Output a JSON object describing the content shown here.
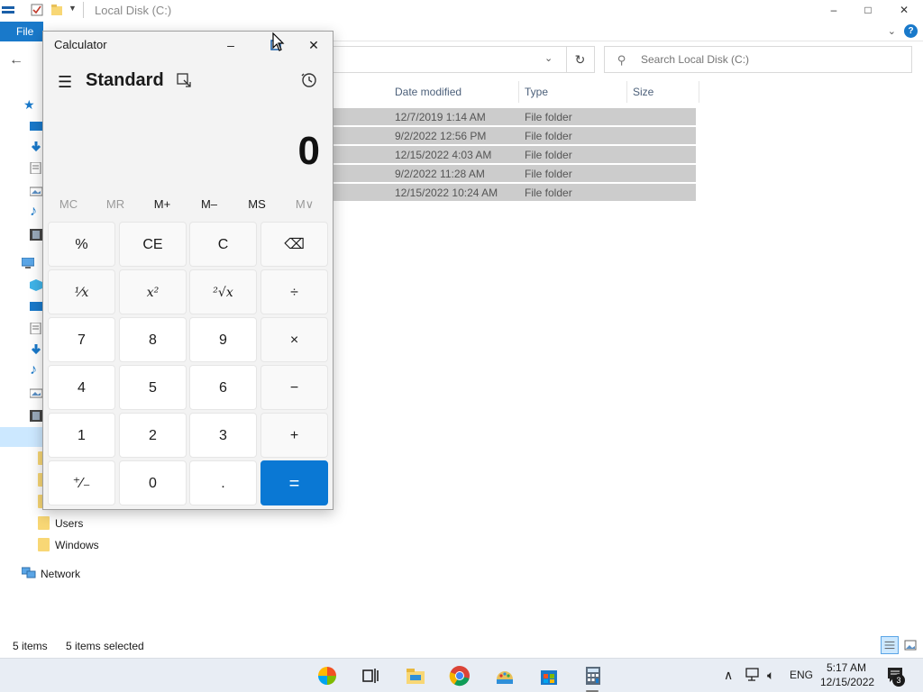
{
  "explorer": {
    "title": "Local Disk (C:)",
    "file_tab": "File",
    "minimize": "–",
    "maximize": "□",
    "close": "✕",
    "search_placeholder": "Search Local Disk (C:)",
    "columns": {
      "date": "Date modified",
      "type": "Type",
      "size": "Size"
    },
    "rows": [
      {
        "date": "12/7/2019 1:14 AM",
        "type": "File folder"
      },
      {
        "date": "9/2/2022 12:56 PM",
        "type": "File folder"
      },
      {
        "date": "12/15/2022 4:03 AM",
        "type": "File folder"
      },
      {
        "date": "9/2/2022 11:28 AM",
        "type": "File folder"
      },
      {
        "date": "12/15/2022 10:24 AM",
        "type": "File folder"
      }
    ],
    "nav": {
      "users": "Users",
      "windows": "Windows",
      "network": "Network"
    },
    "status": {
      "items": "5 items",
      "selected": "5 items selected"
    }
  },
  "calculator": {
    "title": "Calculator",
    "minimize": "–",
    "close": "✕",
    "mode": "Standard",
    "display": "0",
    "memory": [
      "MC",
      "MR",
      "M+",
      "M–",
      "MS",
      "M∨"
    ],
    "keys": {
      "percent": "%",
      "ce": "CE",
      "c": "C",
      "backspace": "⌫",
      "reciprocal": "¹⁄x",
      "square": "x²",
      "sqrt": "²√x",
      "divide": "÷",
      "seven": "7",
      "eight": "8",
      "nine": "9",
      "multiply": "×",
      "four": "4",
      "five": "5",
      "six": "6",
      "minus": "−",
      "one": "1",
      "two": "2",
      "three": "3",
      "plus": "+",
      "negate": "⁺⁄₋",
      "zero": "0",
      "decimal": ".",
      "equals": "="
    }
  },
  "taskbar": {
    "language": "ENG",
    "time": "5:17 AM",
    "date": "12/15/2022",
    "notifications": "3"
  },
  "colors": {
    "accent": "#0a78d4",
    "file_tab": "#1979ca",
    "selection": "#cccccc"
  }
}
